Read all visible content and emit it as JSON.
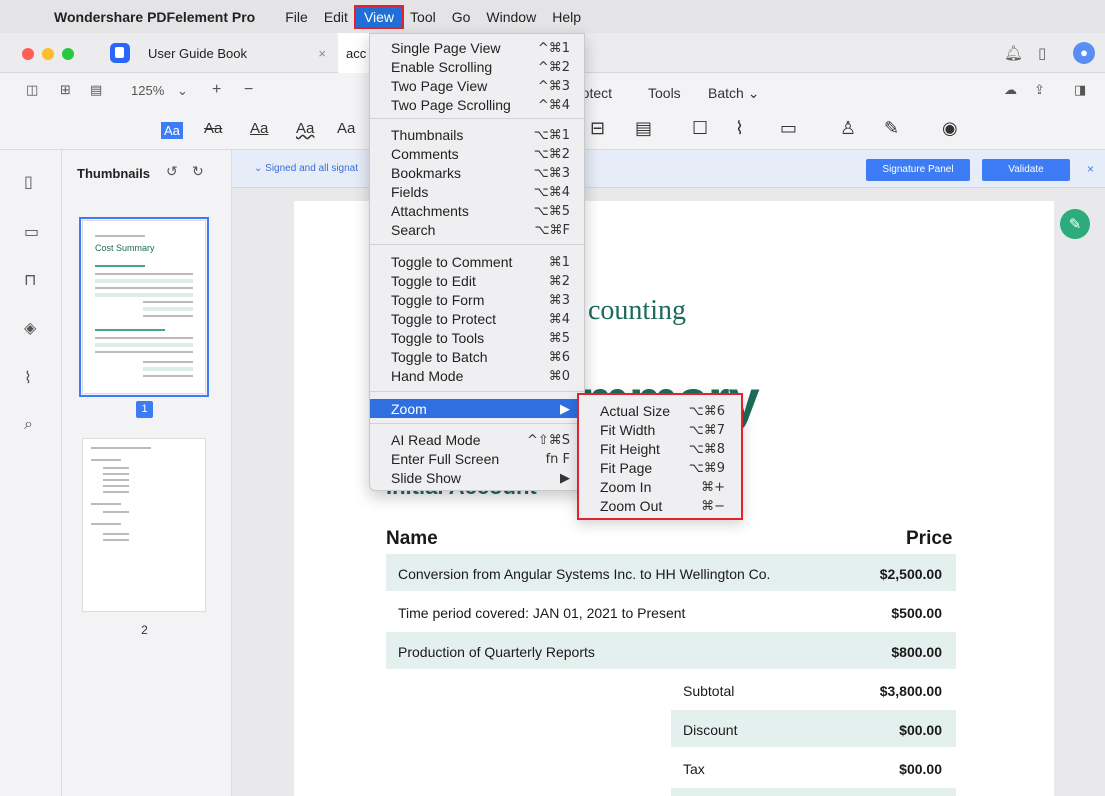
{
  "menubar": {
    "app_name": "Wondershare PDFelement Pro",
    "menus": [
      "File",
      "Edit",
      "View",
      "Tool",
      "Go",
      "Window",
      "Help"
    ],
    "active_menu": "View"
  },
  "tabs": [
    {
      "label": "User Guide Book",
      "close": "×"
    },
    {
      "label": "acc"
    }
  ],
  "toolbar": {
    "zoom": "125%",
    "zoom_chevron": "⌄",
    "plus": "+",
    "minus": "−",
    "protect": "rotect",
    "tools": "Tools",
    "batch": "Batch ⌄"
  },
  "ribbon": {
    "font_styles": [
      "Aa",
      "Aa",
      "Aa",
      "Aa",
      "Aa"
    ]
  },
  "thumbnails": {
    "title": "Thumbnails",
    "page1": "1",
    "page2": "2",
    "thumb1_title": "Cost Summary"
  },
  "signature_bar": {
    "text": "⌄ Signed and all signat",
    "signature_panel": "Signature Panel",
    "validate": "Validate",
    "close": "×"
  },
  "document": {
    "heading1": "counting",
    "heading2": "mmary",
    "heading3": "Initial Account",
    "col_name": "Name",
    "col_price": "Price",
    "rows": [
      {
        "desc": "Conversion from Angular Systems Inc. to HH Wellington Co.",
        "price": "$2,500.00"
      },
      {
        "desc": "Time period covered: JAN 01, 2021 to Present",
        "price": "$500.00"
      },
      {
        "desc": "Production of Quarterly Reports",
        "price": "$800.00"
      }
    ],
    "summary": [
      {
        "label": "Subtotal",
        "value": "$3,800.00"
      },
      {
        "label": "Discount",
        "value": "$00.00"
      },
      {
        "label": "Tax",
        "value": "$00.00"
      }
    ]
  },
  "view_menu": {
    "group1": [
      {
        "label": "Single Page View",
        "key": "^⌘1"
      },
      {
        "label": "Enable Scrolling",
        "key": "^⌘2"
      },
      {
        "label": "Two Page View",
        "key": "^⌘3"
      },
      {
        "label": "Two Page Scrolling",
        "key": "^⌘4"
      }
    ],
    "group2": [
      {
        "label": "Thumbnails",
        "key": "⌥⌘1"
      },
      {
        "label": "Comments",
        "key": "⌥⌘2"
      },
      {
        "label": "Bookmarks",
        "key": "⌥⌘3"
      },
      {
        "label": "Fields",
        "key": "⌥⌘4"
      },
      {
        "label": "Attachments",
        "key": "⌥⌘5"
      },
      {
        "label": "Search",
        "key": "⌥⌘F"
      }
    ],
    "group3": [
      {
        "label": "Toggle to Comment",
        "key": "⌘1"
      },
      {
        "label": "Toggle to Edit",
        "key": "⌘2"
      },
      {
        "label": "Toggle to Form",
        "key": "⌘3"
      },
      {
        "label": "Toggle to Protect",
        "key": "⌘4"
      },
      {
        "label": "Toggle to Tools",
        "key": "⌘5"
      },
      {
        "label": "Toggle to Batch",
        "key": "⌘6"
      },
      {
        "label": "Hand Mode",
        "key": "⌘0"
      }
    ],
    "zoom": {
      "label": "Zoom",
      "key": "▶"
    },
    "group5": [
      {
        "label": "AI Read Mode",
        "key": "^⇧⌘S"
      },
      {
        "label": "Enter Full Screen",
        "key": "fn F"
      },
      {
        "label": "Slide Show",
        "key": "▶"
      }
    ]
  },
  "zoom_menu": [
    {
      "label": "Actual Size",
      "key": "⌥⌘6"
    },
    {
      "label": "Fit Width",
      "key": "⌥⌘7"
    },
    {
      "label": "Fit Height",
      "key": "⌥⌘8"
    },
    {
      "label": "Fit Page",
      "key": "⌥⌘9"
    },
    {
      "label": "Zoom In",
      "key": "⌘+"
    },
    {
      "label": "Zoom Out",
      "key": "⌘−"
    }
  ],
  "colors": {
    "accent": "#3d7cf4",
    "highlight_border": "#e0242f",
    "doc_green": "#1d6b5a",
    "row_fill": "#e4f0ee"
  }
}
